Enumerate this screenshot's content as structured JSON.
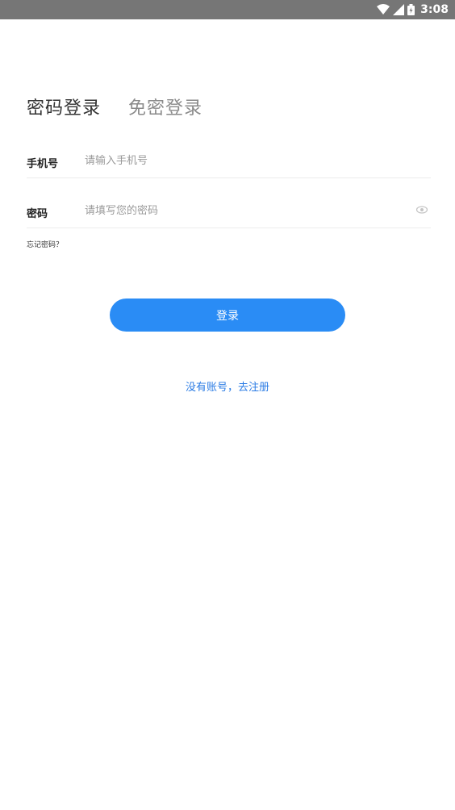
{
  "status_bar": {
    "time": "3:08"
  },
  "tabs": [
    {
      "label": "密码登录"
    },
    {
      "label": "免密登录"
    }
  ],
  "phone_field": {
    "label": "手机号",
    "placeholder": "请输入手机号",
    "value": ""
  },
  "password_field": {
    "label": "密码",
    "placeholder": "请填写您的密码",
    "value": ""
  },
  "forgot_password": "忘记密码？",
  "login_button": "登录",
  "register_link": "没有账号，去注册",
  "colors": {
    "primary": "#2a8cf5",
    "link": "#2a7be4",
    "status_bar": "#767676"
  },
  "icons": [
    "wifi-icon",
    "signal-icon",
    "battery-icon",
    "eye-icon"
  ]
}
